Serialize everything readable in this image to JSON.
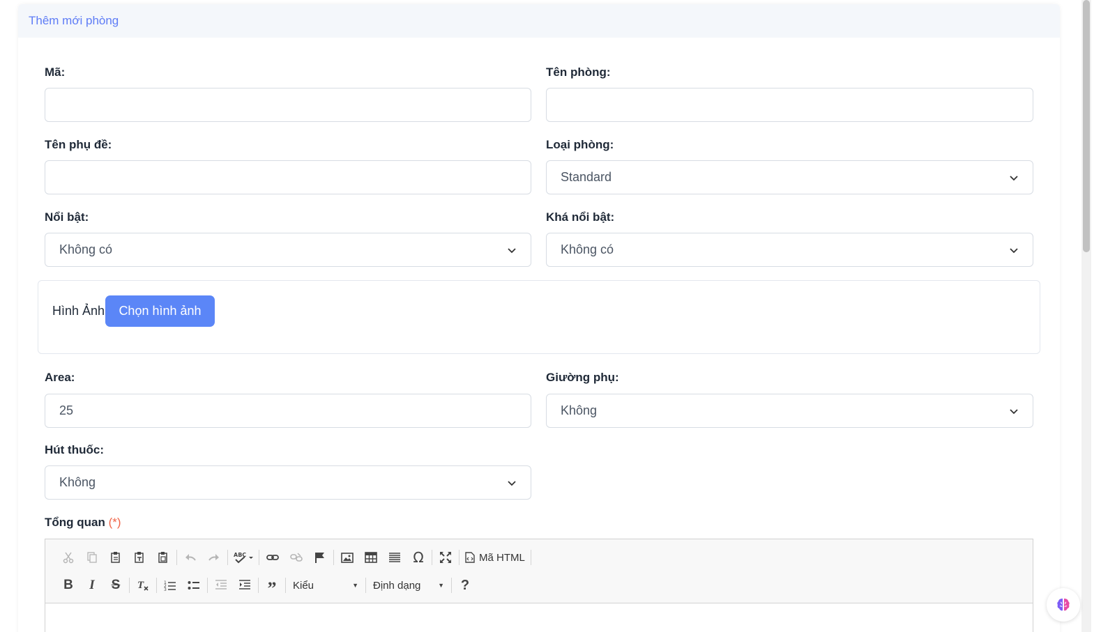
{
  "header": {
    "title": "Thêm mới phòng"
  },
  "form": {
    "ma": {
      "label": "Mã:",
      "value": ""
    },
    "ten_phong": {
      "label": "Tên phòng:",
      "value": ""
    },
    "ten_phu_de": {
      "label": "Tên phụ đề:",
      "value": ""
    },
    "loai_phong": {
      "label": "Loại phòng:",
      "value": "Standard"
    },
    "noi_bat": {
      "label": "Nổi bật:",
      "value": "Không có"
    },
    "kha_noi_bat": {
      "label": "Khá nổi bật:",
      "value": "Không có"
    },
    "hinh_anh": {
      "label": "Hình Ảnh",
      "button": "Chọn hình ảnh"
    },
    "area": {
      "label": "Area:",
      "value": "25"
    },
    "giuong_phu": {
      "label": "Giường phụ:",
      "value": "Không"
    },
    "hut_thuoc": {
      "label": "Hút thuốc:",
      "value": "Không"
    },
    "tong_quan": {
      "label": "Tổng quan",
      "required": "(*)"
    }
  },
  "editor": {
    "source_button": "Mã HTML",
    "style_combo": "Kiểu",
    "format_combo": "Định dạng"
  },
  "colors": {
    "accent": "#5b86f7",
    "header_text": "#5e7cf6",
    "required": "#f06548"
  }
}
